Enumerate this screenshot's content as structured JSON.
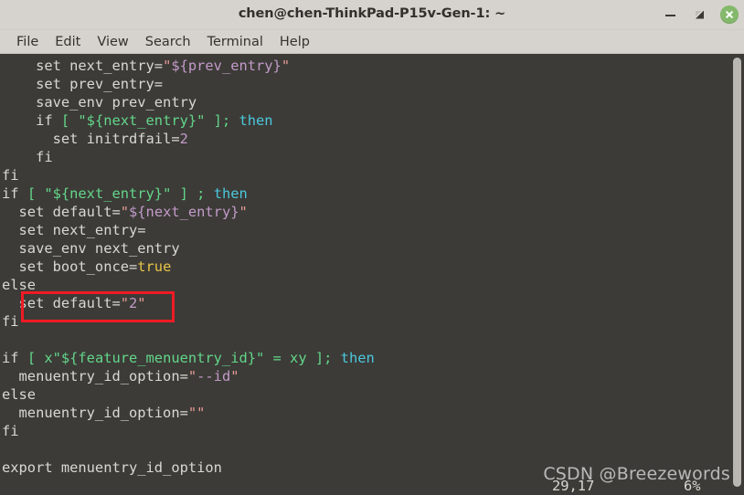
{
  "window": {
    "title": "chen@chen-ThinkPad-P15v-Gen-1: ~",
    "controls": {
      "minimize_label": "minimize",
      "maximize_label": "restore",
      "close_label": "close"
    }
  },
  "menubar": {
    "items": [
      {
        "label": "File"
      },
      {
        "label": "Edit"
      },
      {
        "label": "View"
      },
      {
        "label": "Search"
      },
      {
        "label": "Terminal"
      },
      {
        "label": "Help"
      }
    ]
  },
  "terminal": {
    "lines": [
      [
        {
          "t": "    set next_entry=",
          "c": "plain"
        },
        {
          "t": "\"",
          "c": "quote"
        },
        {
          "t": "${prev_entry}",
          "c": "purple"
        },
        {
          "t": "\"",
          "c": "quote"
        }
      ],
      [
        {
          "t": "    set prev_entry=",
          "c": "plain"
        }
      ],
      [
        {
          "t": "    save_env prev_entry",
          "c": "plain"
        }
      ],
      [
        {
          "t": "    if ",
          "c": "plain"
        },
        {
          "t": "[ \"${next_entry}\" ];",
          "c": "green"
        },
        {
          "t": " ",
          "c": "plain"
        },
        {
          "t": "then",
          "c": "cyan"
        }
      ],
      [
        {
          "t": "      set initrdfail=",
          "c": "plain"
        },
        {
          "t": "2",
          "c": "purple"
        }
      ],
      [
        {
          "t": "    fi",
          "c": "plain"
        }
      ],
      [
        {
          "t": "fi",
          "c": "plain"
        }
      ],
      [
        {
          "t": "if ",
          "c": "plain"
        },
        {
          "t": "[ \"${next_entry}\" ]",
          "c": "green"
        },
        {
          "t": " ",
          "c": "plain"
        },
        {
          "t": ";",
          "c": "green"
        },
        {
          "t": " ",
          "c": "plain"
        },
        {
          "t": "then",
          "c": "cyan"
        }
      ],
      [
        {
          "t": "  set default=",
          "c": "plain"
        },
        {
          "t": "\"",
          "c": "quote"
        },
        {
          "t": "${next_entry}",
          "c": "purple"
        },
        {
          "t": "\"",
          "c": "quote"
        }
      ],
      [
        {
          "t": "  set next_entry=",
          "c": "plain"
        }
      ],
      [
        {
          "t": "  save_env next_entry",
          "c": "plain"
        }
      ],
      [
        {
          "t": "  set boot_once=",
          "c": "plain"
        },
        {
          "t": "true",
          "c": "yellow"
        }
      ],
      [
        {
          "t": "else",
          "c": "plain"
        }
      ],
      [
        {
          "t": "  set default=",
          "c": "plain"
        },
        {
          "t": "\"",
          "c": "quote"
        },
        {
          "t": "2",
          "c": "purple"
        },
        {
          "t": "\"",
          "c": "quote"
        }
      ],
      [
        {
          "t": "fi",
          "c": "plain"
        }
      ],
      [
        {
          "t": "",
          "c": "plain"
        }
      ],
      [
        {
          "t": "if ",
          "c": "plain"
        },
        {
          "t": "[ x\"${feature_menuentry_id}\" = xy ];",
          "c": "green"
        },
        {
          "t": " ",
          "c": "plain"
        },
        {
          "t": "then",
          "c": "cyan"
        }
      ],
      [
        {
          "t": "  menuentry_id_option=",
          "c": "plain"
        },
        {
          "t": "\"",
          "c": "quote"
        },
        {
          "t": "--id",
          "c": "purple"
        },
        {
          "t": "\"",
          "c": "quote"
        }
      ],
      [
        {
          "t": "else",
          "c": "plain"
        }
      ],
      [
        {
          "t": "  menuentry_id_option=",
          "c": "plain"
        },
        {
          "t": "\"\"",
          "c": "quote"
        }
      ],
      [
        {
          "t": "fi",
          "c": "plain"
        }
      ],
      [
        {
          "t": "",
          "c": "plain"
        }
      ],
      [
        {
          "t": "export menuentry_id_option",
          "c": "plain"
        }
      ]
    ],
    "status": {
      "cursor_position": "29,17",
      "scroll_percent": "6%"
    },
    "highlight_box": {
      "color": "#ee1b24",
      "target_line_text": "set default=\"2\""
    }
  },
  "watermark": {
    "text": "CSDN @Breezewords"
  },
  "colors": {
    "terminal_background": "#3c3b37",
    "titlebar_background": "#d6d2cd",
    "close_button": "#84b96b",
    "syntax_plain": "#d9d8d2",
    "syntax_green": "#63d68a",
    "syntax_cyan": "#4bc8dd",
    "syntax_purple": "#c39ac9",
    "syntax_quote": "#e79a95",
    "syntax_yellow": "#e8c547"
  }
}
